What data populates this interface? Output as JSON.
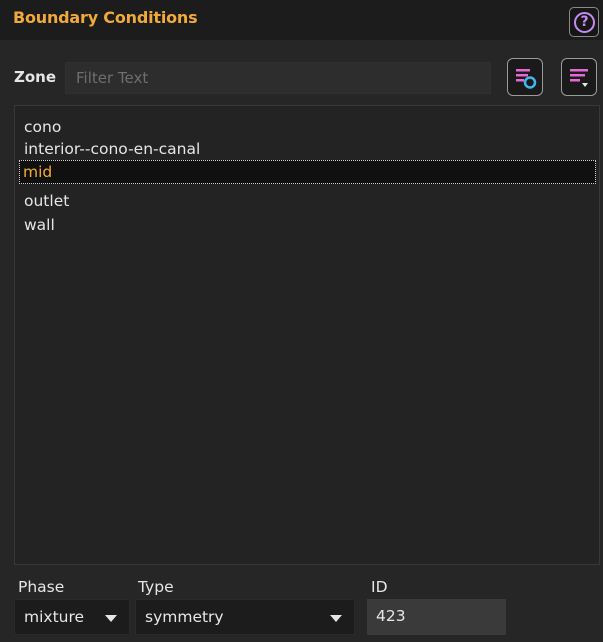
{
  "panel": {
    "title": "Boundary Conditions",
    "help_icon_label": "?"
  },
  "filter": {
    "label": "Zone",
    "placeholder": "Filter Text",
    "value": ""
  },
  "zones": {
    "items": [
      {
        "label": "cono",
        "selected": false
      },
      {
        "label": "interior--cono-en-canal",
        "selected": false
      },
      {
        "label": "mid",
        "selected": true
      },
      {
        "label": "outlet",
        "selected": false
      },
      {
        "label": "wall",
        "selected": false
      }
    ]
  },
  "properties": {
    "phase_label": "Phase",
    "phase_value": "mixture",
    "type_label": "Type",
    "type_value": "symmetry",
    "id_label": "ID",
    "id_value": "423"
  },
  "icons": {
    "help": "help-circle-icon",
    "filter_search": "filter-list-search-icon",
    "filter_menu": "filter-list-menu-icon",
    "dropdown": "caret-down-icon"
  },
  "colors": {
    "accent": "#f2a93b",
    "icon_magenta": "#e36ad6",
    "icon_cyan": "#3fb8f2",
    "background": "#262626",
    "list_background": "#232323"
  }
}
